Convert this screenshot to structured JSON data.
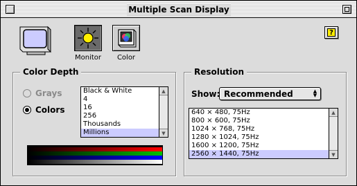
{
  "window": {
    "title": "Multiple Scan Display"
  },
  "toolbar": {
    "items": [
      {
        "label": "Monitor",
        "icon": "sun-icon",
        "selected": true
      },
      {
        "label": "Color",
        "icon": "color-monitor-icon",
        "selected": false
      }
    ],
    "help_label": "?"
  },
  "color_depth": {
    "title": "Color Depth",
    "modes": [
      {
        "label": "Grays",
        "selected": false,
        "enabled": false
      },
      {
        "label": "Colors",
        "selected": true,
        "enabled": true
      }
    ],
    "options": [
      "Black & White",
      "4",
      "16",
      "256",
      "Thousands",
      "Millions"
    ],
    "selected_option": "Millions"
  },
  "resolution": {
    "title": "Resolution",
    "show_label": "Show:",
    "show_value": "Recommended",
    "options": [
      "640 × 480, 75Hz",
      "800 × 600, 75Hz",
      "1024 × 768, 75Hz",
      "1280 × 1024, 75Hz",
      "1600 × 1200, 75Hz",
      "2560 × 1440, 75Hz"
    ],
    "selected_option": "2560 × 1440, 75Hz"
  },
  "colors": {
    "selection_highlight": "#ccccff",
    "window_bg": "#dcdcdc",
    "gradient_bands": [
      "#ff0000",
      "#00c000",
      "#0000ff",
      "#ffffff"
    ]
  }
}
